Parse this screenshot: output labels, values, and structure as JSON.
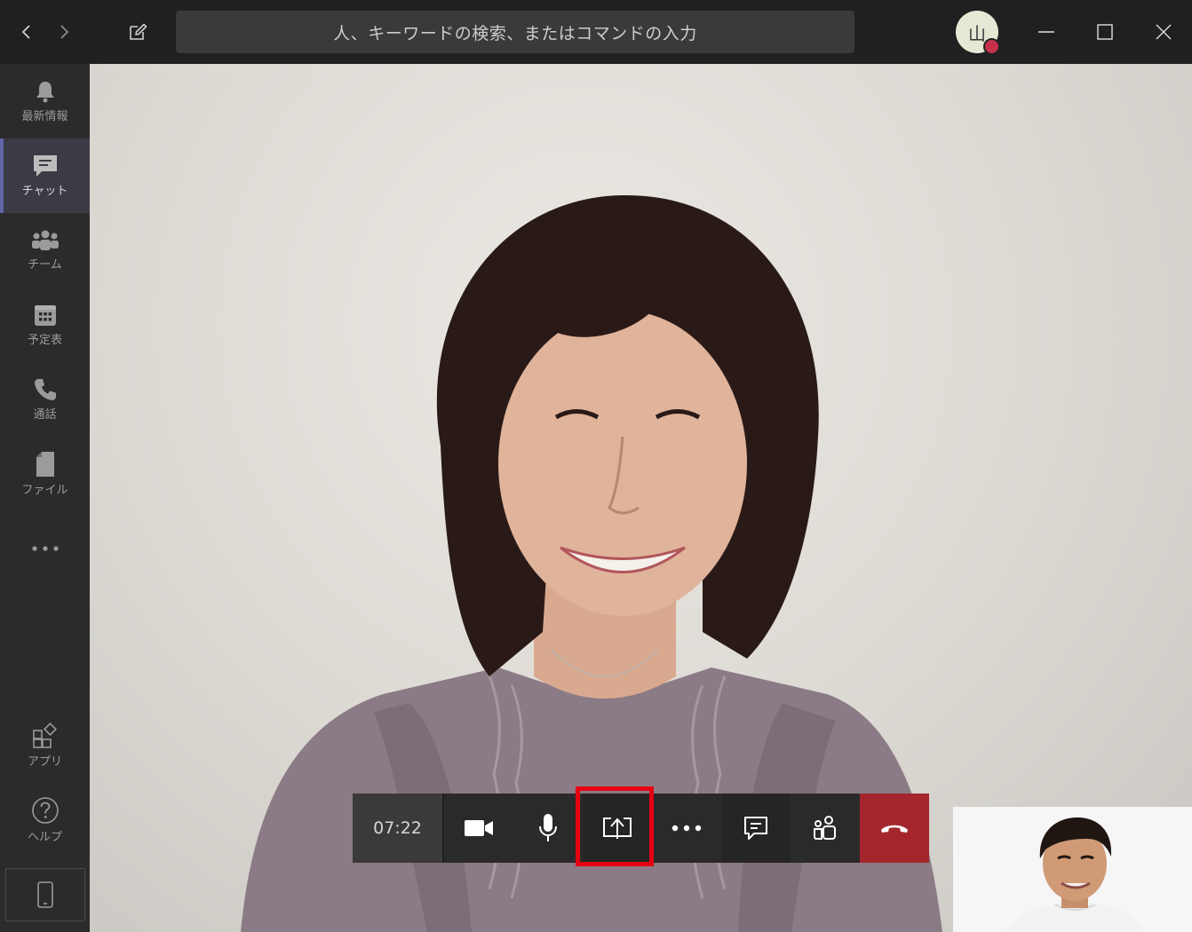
{
  "titlebar": {
    "search_placeholder": "人、キーワードの検索、またはコマンドの入力",
    "avatar_initial": "山",
    "presence_color": "#c4314b"
  },
  "rail": {
    "items": [
      {
        "label": "最新情報",
        "icon": "bell-icon"
      },
      {
        "label": "チャット",
        "icon": "chat-icon",
        "active": true
      },
      {
        "label": "チーム",
        "icon": "teams-icon"
      },
      {
        "label": "予定表",
        "icon": "calendar-icon"
      },
      {
        "label": "通話",
        "icon": "phone-icon"
      },
      {
        "label": "ファイル",
        "icon": "file-icon"
      },
      {
        "label": "アプリ",
        "icon": "apps-icon"
      },
      {
        "label": "ヘルプ",
        "icon": "help-icon"
      }
    ],
    "more_icon": "more-icon",
    "device_icon": "mobile-icon"
  },
  "call": {
    "timer": "07:22",
    "buttons": [
      "camera-icon",
      "microphone-icon",
      "share-screen-icon",
      "more-icon",
      "chat-icon",
      "participants-icon",
      "hang-up-icon"
    ],
    "highlighted": "share-screen-icon",
    "highlight_color": "#e60012",
    "hangup_color": "#a4262c",
    "accent_color": "#6264a7"
  }
}
